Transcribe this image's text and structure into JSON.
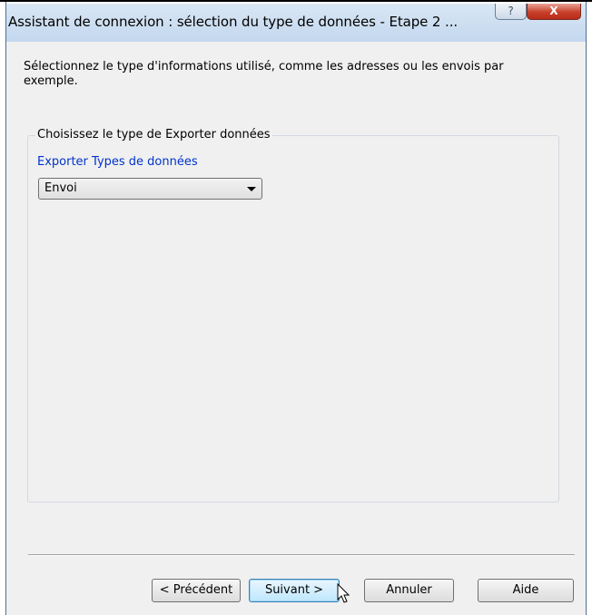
{
  "window": {
    "title": "Assistant de connexion : sélection du type de données - Etape 2 ...",
    "help_button": "?",
    "close_button": "X"
  },
  "instruction": "Sélectionnez le type d'informations utilisé, comme les adresses ou les envois par exemple.",
  "group": {
    "title": "Choisissez le type de Exporter données",
    "field_label": "Exporter Types de données",
    "selected_value": "Envoi"
  },
  "buttons": {
    "previous": "< Précédent",
    "next": "Suivant >",
    "cancel": "Annuler",
    "help": "Aide"
  },
  "colors": {
    "label_blue": "#0033cc",
    "close_red": "#c8402b"
  }
}
